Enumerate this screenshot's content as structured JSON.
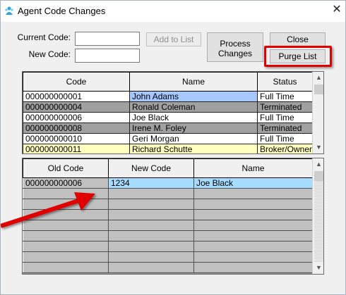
{
  "window": {
    "title": "Agent Code Changes",
    "close_glyph": "✕"
  },
  "form": {
    "current_code_label": "Current Code:",
    "new_code_label": "New Code:",
    "current_code_value": "",
    "new_code_value": ""
  },
  "buttons": {
    "add_to_list": "Add to List",
    "process_changes_line1": "Process",
    "process_changes_line2": "Changes",
    "close": "Close",
    "purge_list": "Purge List"
  },
  "agents_grid": {
    "columns": [
      "Code",
      "Name",
      "Status"
    ],
    "rows": [
      {
        "code": "000000000001",
        "name": "John Adams",
        "status": "Full Time"
      },
      {
        "code": "000000000004",
        "name": "Ronald Coleman",
        "status": "Terminated"
      },
      {
        "code": "000000000006",
        "name": "Joe Black",
        "status": "Full Time"
      },
      {
        "code": "000000000008",
        "name": "Irene M. Foley",
        "status": "Terminated"
      },
      {
        "code": "000000000010",
        "name": "Geri Morgan",
        "status": "Full Time"
      },
      {
        "code": "000000000011",
        "name": "Richard Schutte",
        "status": "Broker/Owner"
      }
    ]
  },
  "changes_grid": {
    "columns": [
      "Old Code",
      "New Code",
      "Name"
    ],
    "rows": [
      {
        "old_code": "000000000006",
        "new_code": "1234",
        "name": "Joe Black"
      }
    ]
  },
  "icons": {
    "app": "app-icon",
    "annotation": "red-arrow-annotation"
  },
  "colors": {
    "highlight": "#e00000",
    "selected_row": "#a6dcff",
    "terminated_row": "#a0a0a0",
    "broker_row": "#ffffc0"
  }
}
